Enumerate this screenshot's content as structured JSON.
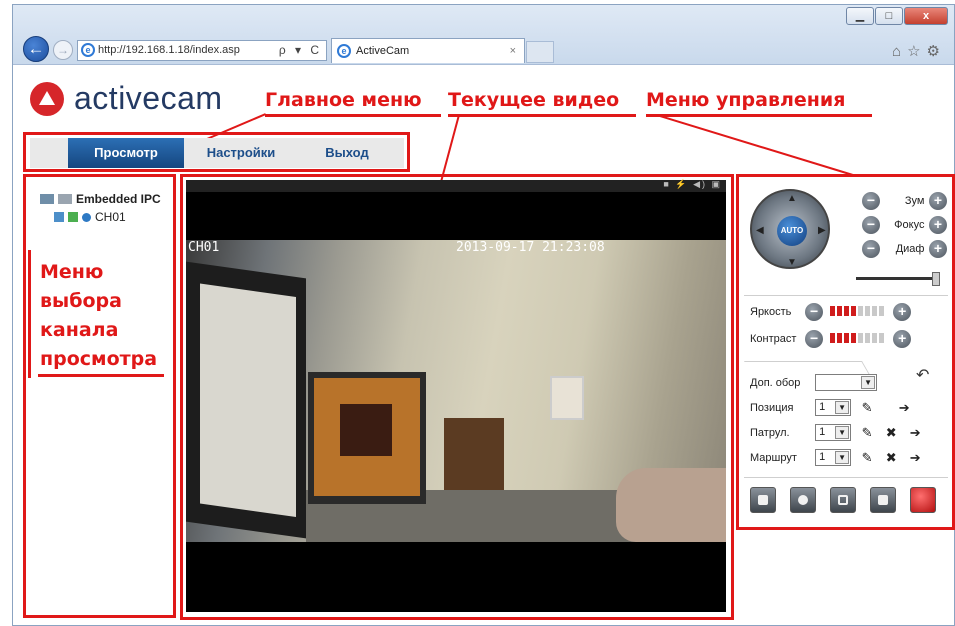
{
  "browser": {
    "url": "http://192.168.1.18/index.asp",
    "address_tools": "ρ ▾ C",
    "tab_title": "ActiveCam",
    "win_minimize": "▁",
    "win_maximize": "□",
    "win_close": "x"
  },
  "brand": {
    "name": "activecam"
  },
  "annotations": {
    "main_menu": "Главное меню",
    "current_video": "Текущее видео",
    "control_menu": "Меню управления",
    "channel_menu": "Меню выбора канала просмотра"
  },
  "main_menu": {
    "items": [
      {
        "label": "Просмотр",
        "active": true
      },
      {
        "label": "Настройки",
        "active": false
      },
      {
        "label": "Выход",
        "active": false
      }
    ]
  },
  "channel_tree": {
    "root": "Embedded IPC",
    "channel": "CH01"
  },
  "video": {
    "channel_osd": "CH01",
    "timestamp_osd": "2013-09-17 21:23:08"
  },
  "controls": {
    "ptz_center": "AUTO",
    "zoom_label": "Зум",
    "focus_label": "Фокус",
    "iris_label": "Диаф",
    "brightness_label": "Яркость",
    "contrast_label": "Контраст",
    "brightness_level": 0.5,
    "contrast_level": 0.5,
    "extra_view_label": "Доп. обор",
    "extra_view_value": "",
    "position_label": "Позиция",
    "position_value": "1",
    "patrol_label": "Патрул.",
    "patrol_value": "1",
    "route_label": "Маршрут",
    "route_value": "1"
  },
  "colors": {
    "accent_red": "#e01818",
    "menu_active": "#1d4e8a",
    "brand_text": "#243a63"
  }
}
